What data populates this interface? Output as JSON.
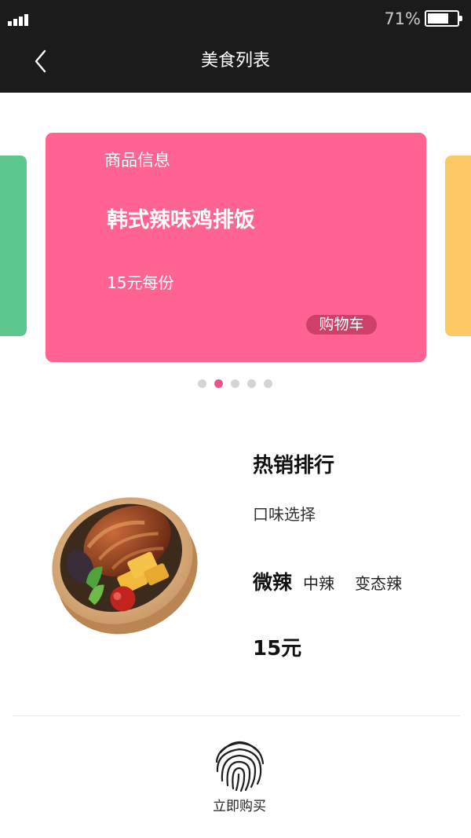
{
  "status_bar": {
    "battery_text": "71%",
    "battery_level": 0.71
  },
  "nav": {
    "title": "美食列表",
    "back_icon": "chevron-left-icon"
  },
  "carousel": {
    "card": {
      "header": "商品信息",
      "name": "韩式辣味鸡排饭",
      "price": "15元每份",
      "cart_label": "购物车",
      "color": "#ff6391"
    },
    "left_card_color": "#5ec78e",
    "right_card_color": "#fcc965",
    "dot_count": 5,
    "active_dot": 2,
    "dot_active_color": "#f25285"
  },
  "product": {
    "section_title": "热销排行",
    "flavor_label": "口味选择",
    "flavors": [
      "微辣",
      "中辣",
      "变态辣"
    ],
    "selected_flavor": "微辣",
    "price": "15元"
  },
  "buy": {
    "label": "立即购买",
    "icon": "fingerprint-icon"
  }
}
